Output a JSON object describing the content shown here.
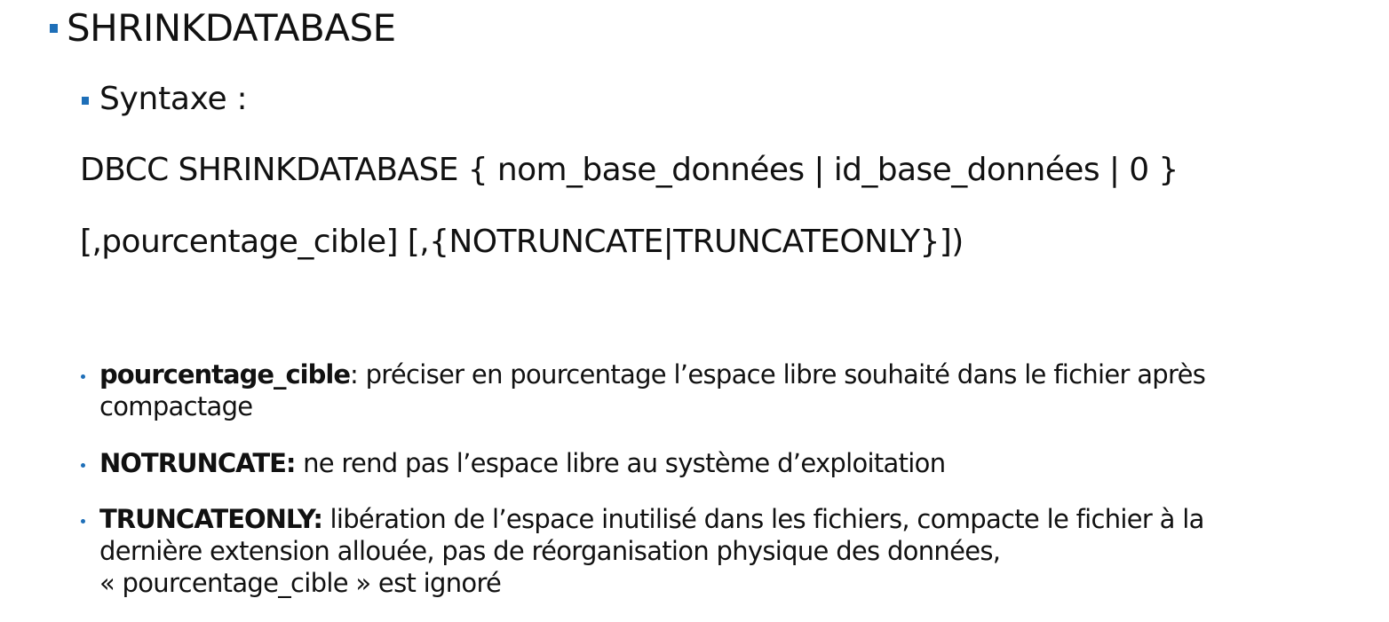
{
  "heading": {
    "title": "SHRINKDATABASE",
    "subtitle": "Syntaxe :"
  },
  "syntax": {
    "line1": "DBCC SHRINKDATABASE { nom_base_données | id_base_données | 0 }",
    "line2": "[,pourcentage_cible]  [,{NOTRUNCATE|TRUNCATEONLY}])"
  },
  "params": [
    {
      "name": "pourcentage_cible",
      "separator": ": ",
      "desc_line1": "préciser en pourcentage l’espace libre souhaité dans le fichier après",
      "desc_line2": "compactage",
      "desc_line3": ""
    },
    {
      "name": "NOTRUNCATE:",
      "separator": " ",
      "desc_line1": "ne rend pas l’espace libre au système d’exploitation",
      "desc_line2": "",
      "desc_line3": ""
    },
    {
      "name": "TRUNCATEONLY:",
      "separator": " ",
      "desc_line1": "libération de l’espace inutilisé dans les fichiers, compacte le fichier à la",
      "desc_line2": "dernière extension allouée, pas de réorganisation physique des données,",
      "desc_line3": "« pourcentage_cible » est ignoré"
    }
  ],
  "colors": {
    "bullet": "#1e6fb8",
    "text": "#111111",
    "background": "#ffffff"
  }
}
